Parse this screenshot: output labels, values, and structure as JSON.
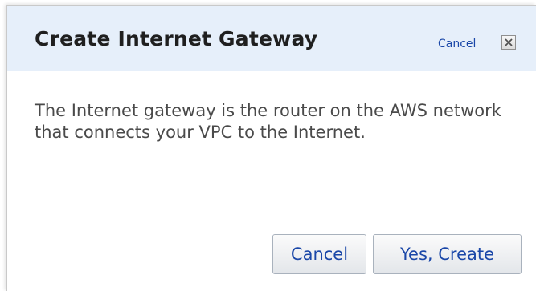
{
  "dialog": {
    "title": "Create Internet Gateway",
    "header_cancel_label": "Cancel",
    "close_icon": "close-icon",
    "description": "The Internet gateway is the router on the AWS network that connects your VPC to the Internet.",
    "buttons": {
      "cancel_label": "Cancel",
      "create_label": "Yes, Create"
    }
  },
  "colors": {
    "header_background": "#e6effa",
    "link_blue": "#1a47a8",
    "body_text": "#4a4a4a"
  }
}
